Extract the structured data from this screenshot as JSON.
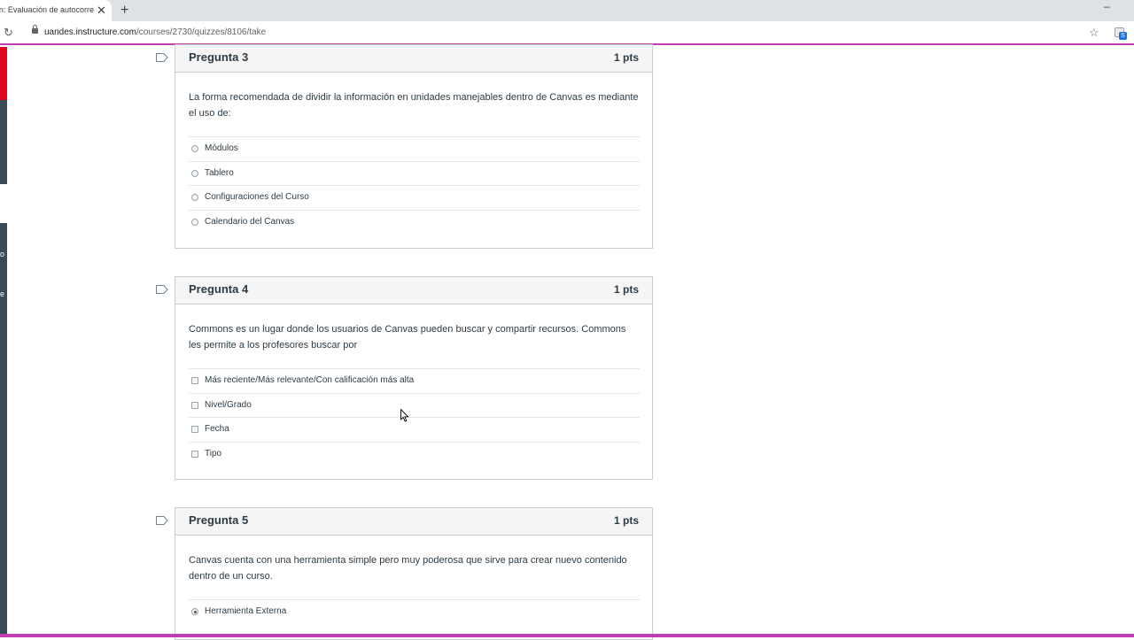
{
  "browser": {
    "tab_title": "en: Evaluación de autocorre",
    "url_host": "uandes.instructure.com",
    "url_path": "/courses/2730/quizzes/8106/take"
  },
  "sidebar": {
    "letter1": "o",
    "letter2": "e"
  },
  "questions": [
    {
      "name": "Pregunta 3",
      "points": "1 pts",
      "text": "La forma recomendada de dividir la información en unidades manejables dentro de Canvas es mediante el uso de:",
      "type": "radio",
      "answers": [
        "Módulos",
        "Tablero",
        "Configuraciones del Curso",
        "Calendario del Canvas"
      ]
    },
    {
      "name": "Pregunta 4",
      "points": "1 pts",
      "text": "Commons es un lugar donde los usuarios de Canvas pueden buscar y compartir recursos.  Commons les permite a los profesores buscar por",
      "type": "checkbox",
      "answers": [
        "Más reciente/Más relevante/Con calificación más alta",
        "Nivel/Grado",
        "Fecha",
        "Tipo"
      ]
    },
    {
      "name": "Pregunta 5",
      "points": "1 pts",
      "text": "Canvas cuenta con una herramienta simple pero muy poderosa que sirve para crear nuevo contenido dentro de un curso.",
      "type": "radio",
      "answers": [
        "Herramienta Externa"
      ],
      "selected": "Herramienta Externa"
    }
  ]
}
